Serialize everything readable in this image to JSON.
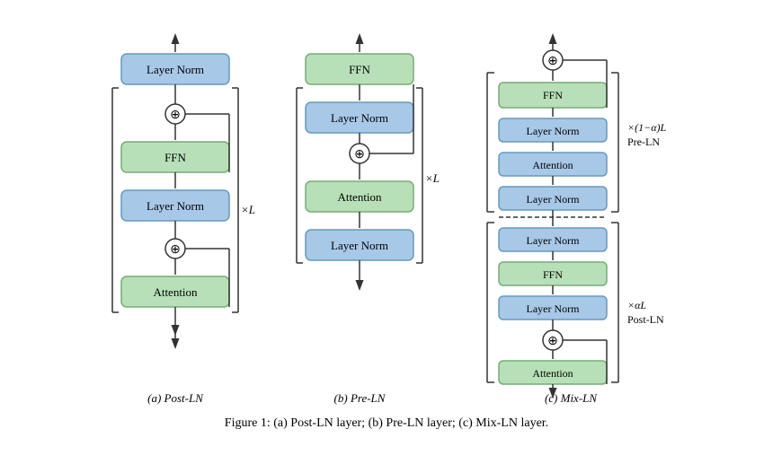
{
  "figure": {
    "caption": "Figure 1: (a) Post-LN layer; (b) Pre-LN layer; (c) Mix-LN layer.",
    "diagrams": [
      {
        "id": "post-ln",
        "label": "(a) Post-LN",
        "blocks": [
          {
            "text": "Layer Norm",
            "type": "blue"
          },
          {
            "text": "⊕",
            "type": "circle"
          },
          {
            "text": "FFN",
            "type": "green"
          },
          {
            "text": "Layer Norm",
            "type": "blue"
          },
          {
            "text": "⊕",
            "type": "circle"
          },
          {
            "text": "Attention",
            "type": "green"
          }
        ],
        "multiplier": "×L"
      },
      {
        "id": "pre-ln",
        "label": "(b) Pre-LN",
        "blocks": [
          {
            "text": "FFN",
            "type": "green"
          },
          {
            "text": "Layer Norm",
            "type": "blue"
          },
          {
            "text": "⊕",
            "type": "circle"
          },
          {
            "text": "Attention",
            "type": "green"
          },
          {
            "text": "Layer Norm",
            "type": "blue"
          }
        ],
        "multiplier": "×L"
      },
      {
        "id": "mix-ln",
        "label": "(c) Mix-LN",
        "blocks_top": [
          {
            "text": "⊕",
            "type": "circle"
          },
          {
            "text": "FFN",
            "type": "green"
          },
          {
            "text": "Layer Norm",
            "type": "blue"
          },
          {
            "text": "Attention",
            "type": "blue"
          },
          {
            "text": "Layer Norm",
            "type": "blue"
          }
        ],
        "blocks_bottom": [
          {
            "text": "Layer Norm",
            "type": "blue"
          },
          {
            "text": "FFN",
            "type": "green"
          },
          {
            "text": "Layer Norm",
            "type": "blue"
          },
          {
            "text": "⊕",
            "type": "circle"
          },
          {
            "text": "Attention",
            "type": "green"
          }
        ],
        "multiplier_top": "×(1−α)L Pre-LN",
        "multiplier_bottom": "×αL Post-LN"
      }
    ]
  }
}
